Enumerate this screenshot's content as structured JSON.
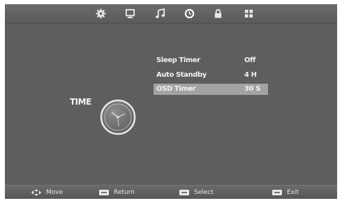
{
  "top_tabs": [
    {
      "name": "picture-settings-tab",
      "icon": "gear-icon"
    },
    {
      "name": "screen-tab",
      "icon": "monitor-icon"
    },
    {
      "name": "audio-tab",
      "icon": "music-note-icon"
    },
    {
      "name": "time-tab",
      "icon": "clock-icon",
      "active": true
    },
    {
      "name": "lock-tab",
      "icon": "lock-icon"
    },
    {
      "name": "setup-tab",
      "icon": "grid-icon"
    }
  ],
  "page": {
    "title": "TIME",
    "icon": "clock-icon"
  },
  "menu": {
    "items": [
      {
        "label": "Sleep Timer",
        "value": "Off"
      },
      {
        "label": "Auto Standby",
        "value": "4 H"
      },
      {
        "label": "OSD Timer",
        "value": "30 S",
        "selected": true
      }
    ]
  },
  "footer": {
    "move": {
      "label": "Move",
      "icon": "arrows-icon"
    },
    "return": {
      "label": "Return",
      "key": "MENU"
    },
    "select": {
      "label": "Select",
      "key": "OK"
    },
    "exit": {
      "label": "Exit",
      "key": "EXIT"
    }
  },
  "colors": {
    "background": "#5e5e5e",
    "selected_row": "#a3a3a3",
    "text": "#f2f2f2"
  }
}
